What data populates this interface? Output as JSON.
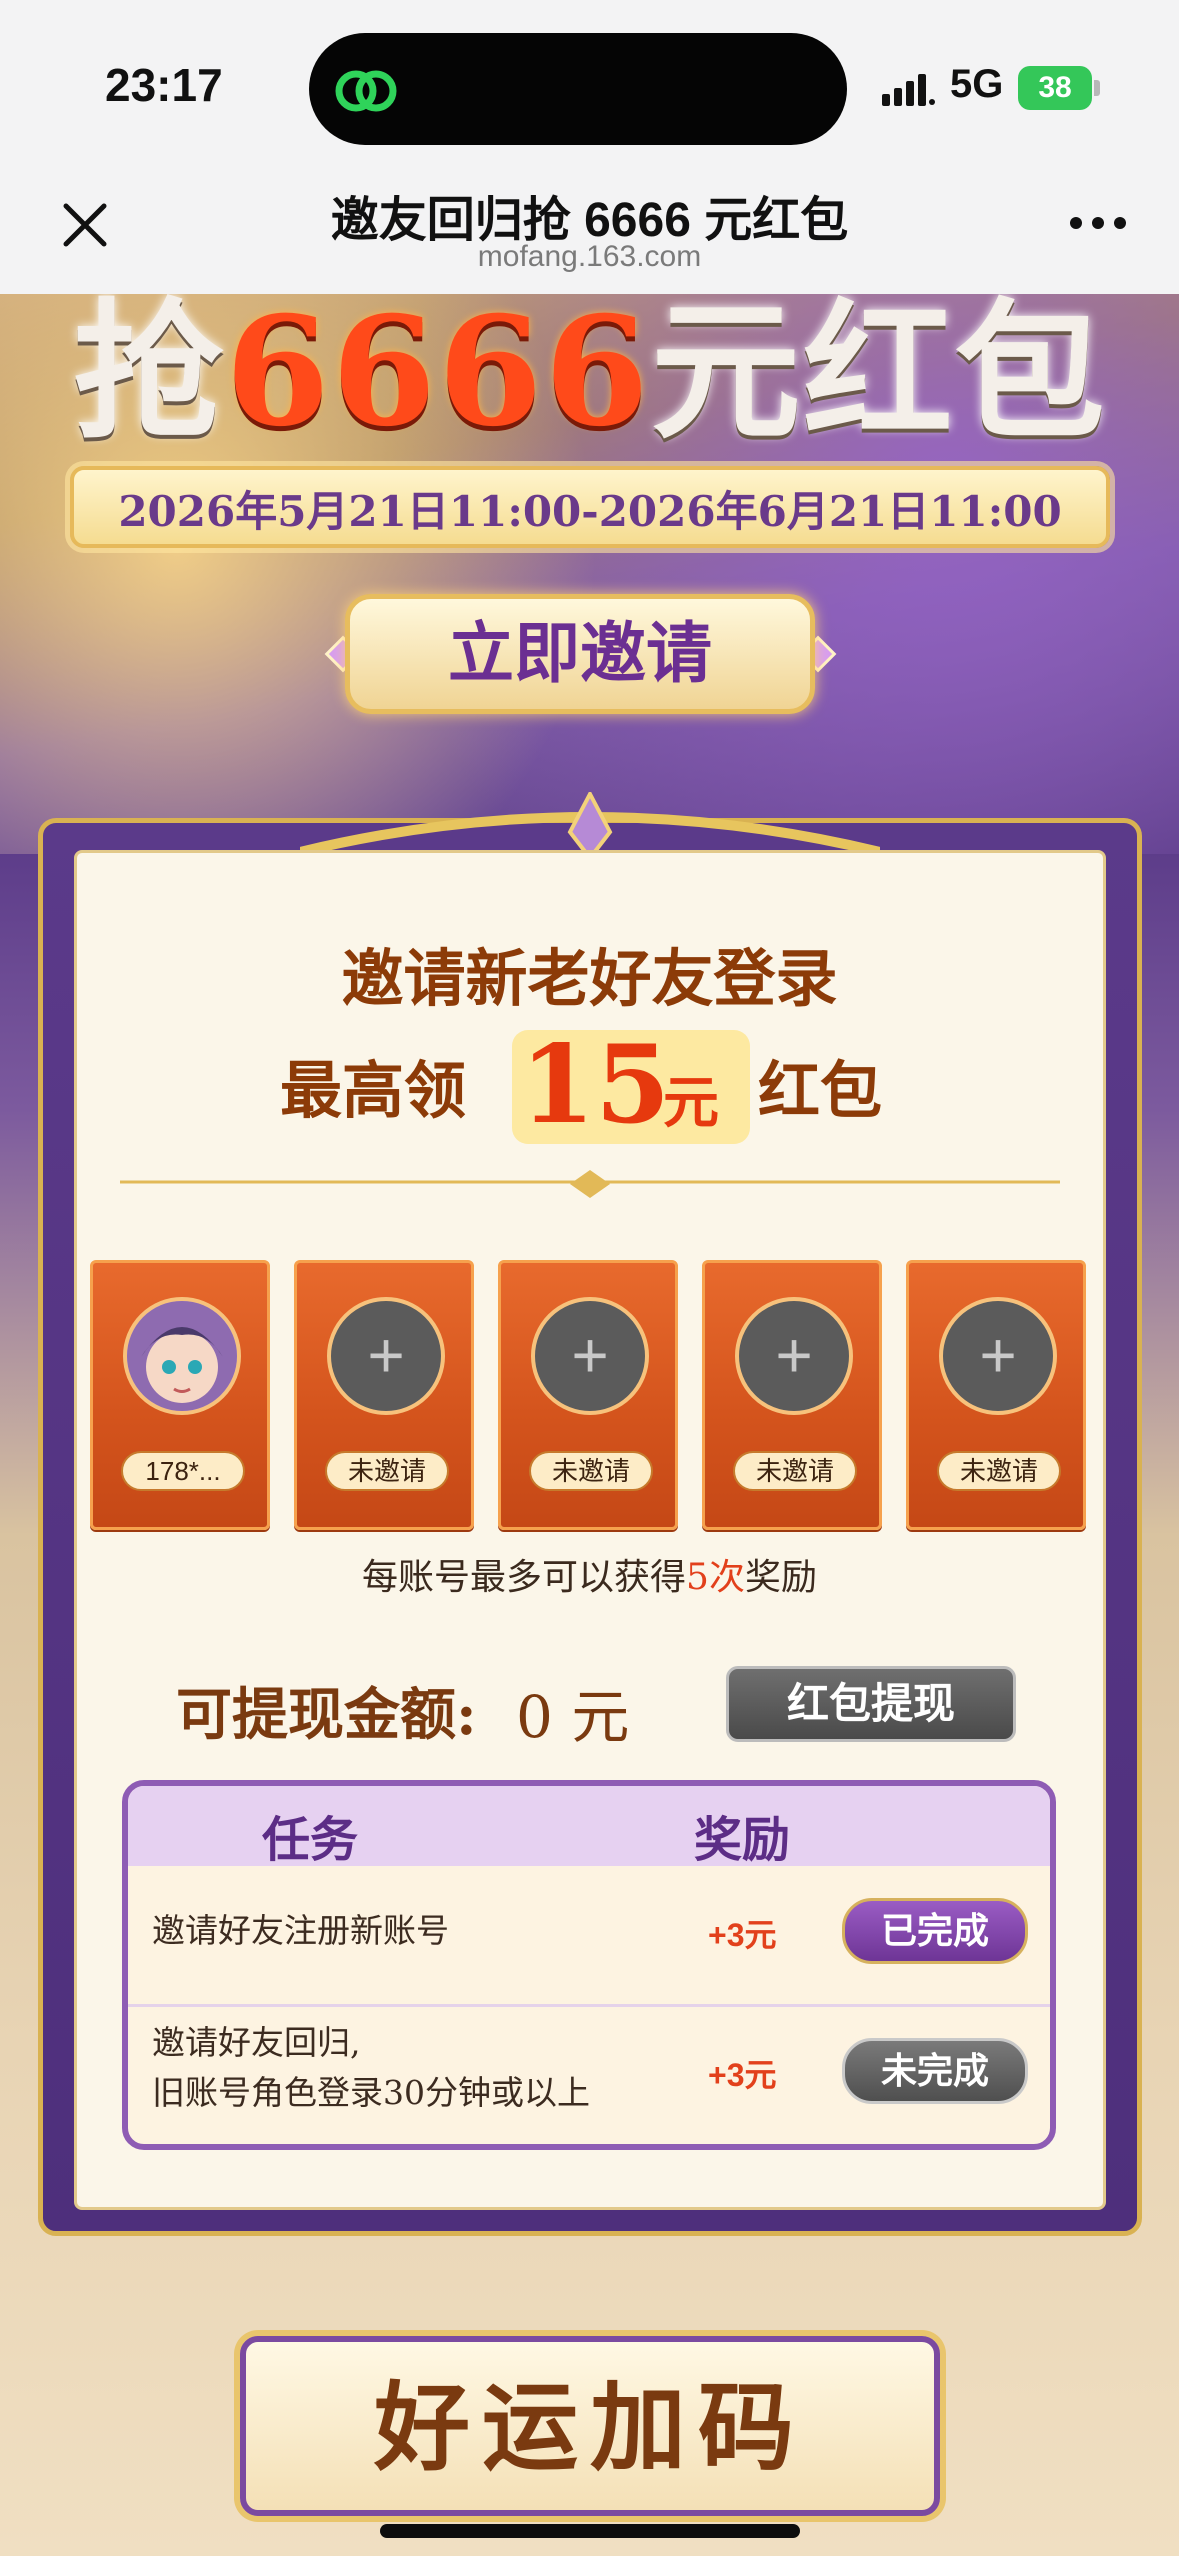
{
  "status_bar": {
    "time": "23:17",
    "network": "5G",
    "battery": "38"
  },
  "nav": {
    "title": "邀友回归抢 6666 元红包",
    "url": "mofang.163.com"
  },
  "hero": {
    "title_part1": "抢",
    "title_amount": "6666",
    "title_part2": "元红包",
    "date_range": "2026年5月21日11:00-2026年6月21日11:00",
    "invite_button": "立即邀请"
  },
  "card": {
    "heading_line1": "邀请新老好友登录",
    "heading_line2_prefix": "最高领",
    "heading_amount": "15",
    "heading_unit": "元",
    "heading_line2_suffix": "红包",
    "slots": [
      {
        "label": "178*...",
        "filled": true
      },
      {
        "label": "未邀请",
        "filled": false
      },
      {
        "label": "未邀请",
        "filled": false
      },
      {
        "label": "未邀请",
        "filled": false
      },
      {
        "label": "未邀请",
        "filled": false
      }
    ],
    "note_prefix": "每账号最多可以获得",
    "note_highlight": "5次",
    "note_suffix": "奖励",
    "cash_label": "可提现金额:",
    "cash_value": "0 元",
    "withdraw_button": "红包提现",
    "table": {
      "header_task": "任务",
      "header_reward": "奖励",
      "rows": [
        {
          "task": "邀请好友注册新账号",
          "reward": "+3元",
          "status": "已完成"
        },
        {
          "task_line1": "邀请好友回归,",
          "task_line2": "旧账号角色登录30分钟或以上",
          "reward": "+3元",
          "status": "未完成"
        }
      ]
    }
  },
  "bottom_banner": "好运加码",
  "colors": {
    "accent_red": "#e6390e",
    "purple": "#6e3596",
    "gold": "#d9b252"
  }
}
